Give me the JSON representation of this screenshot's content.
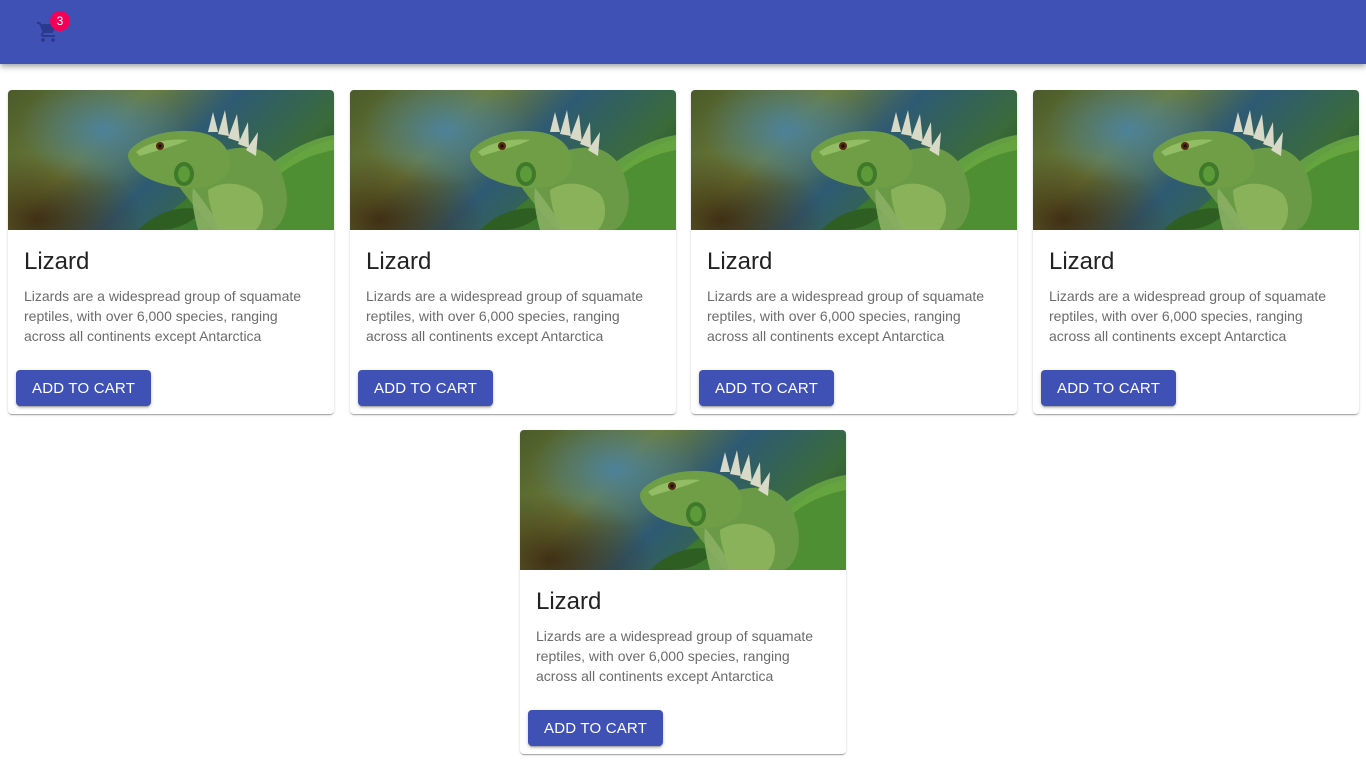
{
  "header": {
    "cart_icon": "shopping-cart-icon",
    "cart_count": "3",
    "bar_color": "#3f51b5",
    "badge_color": "#f50057"
  },
  "products": [
    {
      "image": "iguana-photo",
      "title": "Lizard",
      "description": "Lizards are a widespread group of squamate reptiles, with over 6,000 species, ranging across all continents except Antarctica",
      "button_label": "ADD TO CART"
    },
    {
      "image": "iguana-photo",
      "title": "Lizard",
      "description": "Lizards are a widespread group of squamate reptiles, with over 6,000 species, ranging across all continents except Antarctica",
      "button_label": "ADD TO CART"
    },
    {
      "image": "iguana-photo",
      "title": "Lizard",
      "description": "Lizards are a widespread group of squamate reptiles, with over 6,000 species, ranging across all continents except Antarctica",
      "button_label": "ADD TO CART"
    },
    {
      "image": "iguana-photo",
      "title": "Lizard",
      "description": "Lizards are a widespread group of squamate reptiles, with over 6,000 species, ranging across all continents except Antarctica",
      "button_label": "ADD TO CART"
    },
    {
      "image": "iguana-photo",
      "title": "Lizard",
      "description": "Lizards are a widespread group of squamate reptiles, with over 6,000 species, ranging across all continents except Antarctica",
      "button_label": "ADD TO CART"
    }
  ]
}
